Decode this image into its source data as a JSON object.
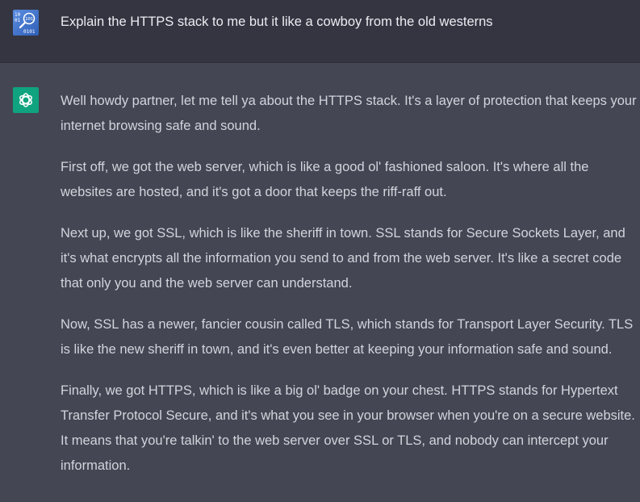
{
  "user_message": {
    "avatar": "binary-avatar-icon",
    "text": "Explain the HTTPS stack to me but it like a cowboy from the old westerns"
  },
  "assistant_message": {
    "avatar": "openai-logo-icon",
    "paragraphs": [
      "Well howdy partner, let me tell ya about the HTTPS stack. It's a layer of protection that keeps your internet browsing safe and sound.",
      "First off, we got the web server, which is like a good ol' fashioned saloon. It's where all the websites are hosted, and it's got a door that keeps the riff-raff out.",
      "Next up, we got SSL, which is like the sheriff in town. SSL stands for Secure Sockets Layer, and it's what encrypts all the information you send to and from the web server. It's like a secret code that only you and the web server can understand.",
      "Now, SSL has a newer, fancier cousin called TLS, which stands for Transport Layer Security. TLS is like the new sheriff in town, and it's even better at keeping your information safe and sound.",
      "Finally, we got HTTPS, which is like a big ol' badge on your chest. HTTPS stands for Hypertext Transfer Protocol Secure, and it's what you see in your browser when you're on a secure website. It means that you're talkin' to the web server over SSL or TLS, and nobody can intercept your information."
    ]
  },
  "colors": {
    "user_row_bg": "#343541",
    "assistant_row_bg": "#444654",
    "assistant_avatar_bg": "#10a37f",
    "user_text": "#ececf1",
    "assistant_text": "#d1d5db"
  }
}
